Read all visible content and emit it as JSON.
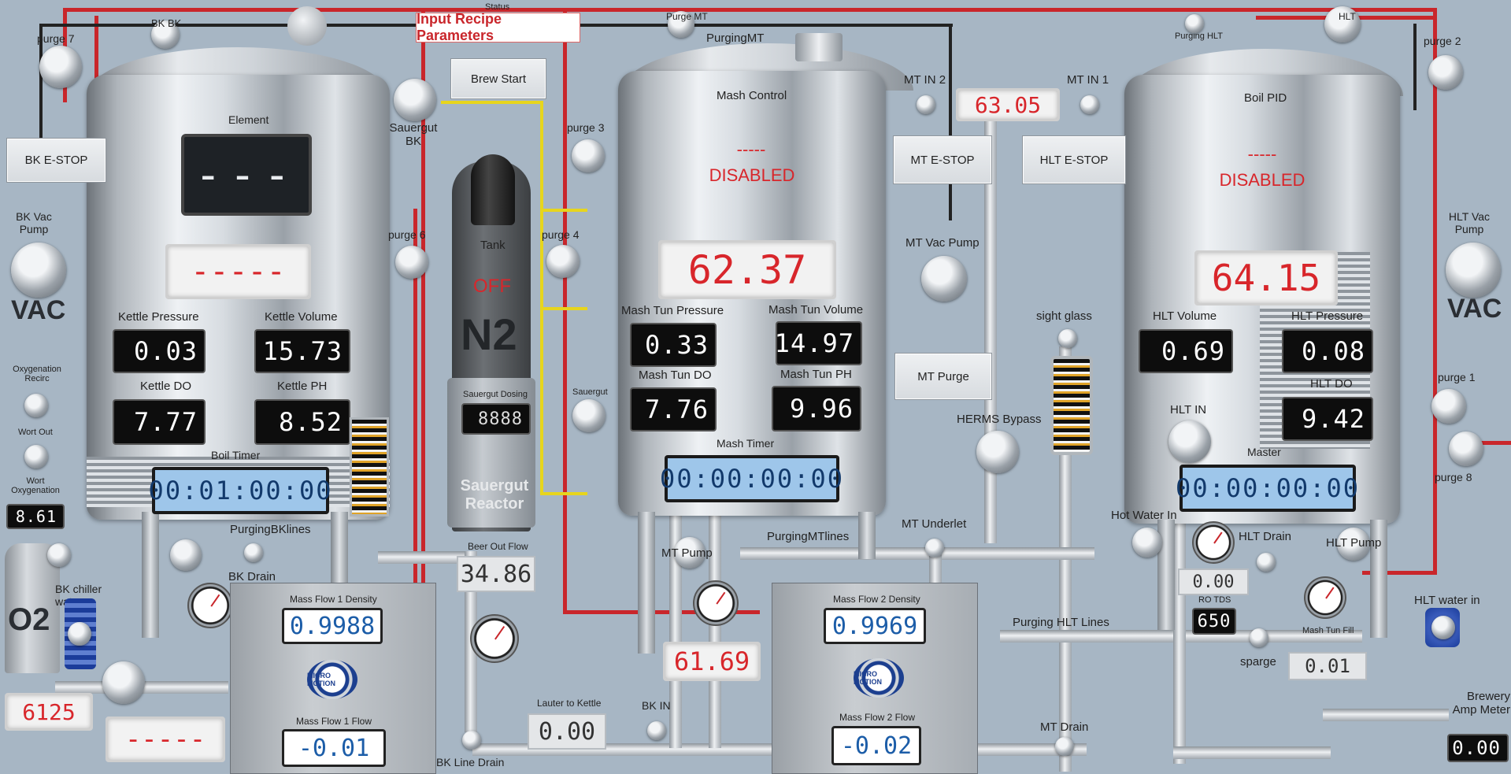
{
  "header": {
    "status_label": "Status",
    "input_recipe_button": "Input Recipe Parameters",
    "brew_start_button": "Brew Start"
  },
  "bk": {
    "estop_button": "BK E-STOP",
    "vac_pump_label": "BK Vac Pump",
    "vac_label": "VAC",
    "element_label": "Element",
    "element_display": "---",
    "setpoint_display": "-----",
    "kettle_pressure_label": "Kettle Pressure",
    "kettle_pressure_value": "0.03",
    "kettle_volume_label": "Kettle Volume",
    "kettle_volume_value": "15.73",
    "kettle_do_label": "Kettle DO",
    "kettle_do_value": "7.77",
    "kettle_ph_label": "Kettle PH",
    "kettle_ph_value": "8.52",
    "boil_timer_label": "Boil Timer",
    "boil_timer_value": "00:01:00:00",
    "purging_lines_label": "PurgingBKlines",
    "drain_label": "BK Drain",
    "chiller_water_label": "BK chiller water",
    "line_drain_label": "BK Line Drain",
    "bottom_display": "-----",
    "left_display": "6125",
    "top_valve_label": "BK BK"
  },
  "oxygen": {
    "recirc_label": "Oxygenation Recirc",
    "wort_out_label": "Wort Out",
    "wort_oxy_label": "Wort Oxygenation",
    "wort_oxy_value": "8.61",
    "o2_label": "O2"
  },
  "purges": {
    "purge7": "purge 7",
    "purge6": "purge 6",
    "purge4": "purge 4",
    "purge3": "purge 3",
    "purge2": "purge 2",
    "purge1": "purge 1",
    "purge8": "purge 8"
  },
  "sauergut": {
    "valve_label": "Sauergut BK",
    "tank_label": "Tank",
    "tank_state": "OFF",
    "n2_label": "N2",
    "dosing_label": "Sauergut Dosing",
    "dosing_value": "8888",
    "reactor_label": "Sauergut Reactor",
    "sauergut_valve_label": "Sauergut"
  },
  "flow": {
    "beer_out_label": "Beer Out Flow",
    "beer_out_value": "34.86",
    "mf1_density_label": "Mass Flow 1 Density",
    "mf1_density_value": "0.9988",
    "mf1_flow_label": "Mass Flow 1 Flow",
    "mf1_flow_value": "-0.01",
    "mf2_density_label": "Mass Flow 2 Density",
    "mf2_density_value": "0.9969",
    "mf2_flow_label": "Mass Flow 2 Flow",
    "mf2_flow_value": "-0.02",
    "micro_motion": "MICRO MOTION",
    "lauter_label": "Lauter to Kettle",
    "lauter_value": "0.00",
    "bk_in_label": "BK IN"
  },
  "mt": {
    "purging_label": "PurgingMT",
    "control_label": "Mash Control",
    "control_dash": "-----",
    "control_state": "DISABLED",
    "temp_display": "62.37",
    "pressure_label": "Mash Tun Pressure",
    "pressure_value": "0.33",
    "volume_label": "Mash Tun Volume",
    "volume_value": "14.97",
    "do_label": "Mash Tun DO",
    "do_value": "7.76",
    "ph_label": "Mash Tun PH",
    "ph_value": "9.96",
    "timer_label": "Mash Timer",
    "timer_value": "00:00:00:00",
    "pump_label": "MT Pump",
    "purging_lines_label": "PurgingMTlines",
    "underlet_label": "MT Underlet",
    "bottom_display": "61.69",
    "in2_label": "MT IN 2",
    "in1_label": "MT IN 1",
    "in_display": "63.05",
    "estop_button": "MT E-STOP",
    "vac_pump_label": "MT Vac Pump",
    "purge_button": "MT Purge",
    "drain_label": "MT Drain",
    "top_valve_label": "Purge MT"
  },
  "hlt": {
    "purging_label": "Purging HLT",
    "pid_label": "Boil PID",
    "pid_dash": "-----",
    "pid_state": "DISABLED",
    "temp_display": "64.15",
    "estop_button": "HLT E-STOP",
    "volume_label": "HLT Volume",
    "volume_value": "0.69",
    "pressure_label": "HLT Pressure",
    "pressure_value": "0.08",
    "in_label": "HLT IN",
    "do_label": "HLT DO",
    "do_value": "9.42",
    "master_label": "Master",
    "master_value": "00:00:00:00",
    "hot_water_label": "Hot Water In",
    "drain_label": "HLT Drain",
    "pump_label": "HLT Pump",
    "ro_value": "0.00",
    "ro_tds_label": "RO TDS",
    "ro_tds_value": "650",
    "sparge_label": "sparge",
    "mash_fill_label": "Mash Tun Fill",
    "mash_fill_value": "0.01",
    "vac_pump_label": "HLT Vac Pump",
    "vac_label": "VAC",
    "water_in_label": "HLT water in",
    "amp_label": "Brewery Amp Meter",
    "amp_value": "0.00",
    "top_valve_label": "HLT"
  },
  "misc": {
    "sight_glass_label": "sight glass",
    "herms_label": "HERMS Bypass",
    "purging_hlt_lines_label": "Purging HLT Lines"
  }
}
